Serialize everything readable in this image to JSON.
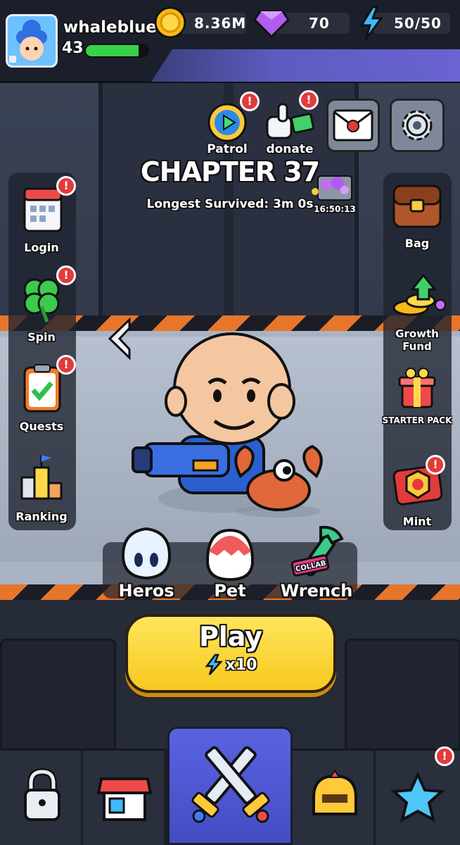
{
  "player": {
    "name": "whaleblue",
    "level": "43",
    "xp_fraction": 0.85
  },
  "resources": {
    "coins": "8.36M",
    "gems": "70",
    "energy": "50/50"
  },
  "top_actions": {
    "patrol": "Patrol",
    "donate": "donate",
    "chest_timer": "16:50:13"
  },
  "left_menu": [
    {
      "label": "Login",
      "icon": "calendar-icon",
      "badge": "!"
    },
    {
      "label": "Spin",
      "icon": "clover-icon",
      "badge": "!"
    },
    {
      "label": "Quests",
      "icon": "clipboard-icon",
      "badge": "!"
    },
    {
      "label": "Ranking",
      "icon": "podium-icon",
      "badge": ""
    }
  ],
  "right_menu": [
    {
      "label": "Bag",
      "icon": "bag-icon",
      "badge": ""
    },
    {
      "label": "Growth Fund",
      "icon": "coins-icon",
      "badge": ""
    },
    {
      "label": "STARTER PACK",
      "icon": "gift-icon",
      "badge": ""
    },
    {
      "label": "Mint",
      "icon": "mint-icon",
      "badge": "!"
    }
  ],
  "chapter": {
    "title": "CHAPTER 37",
    "subtitle": "Longest Survived: 3m 0s"
  },
  "loadout": {
    "heros": "Heros",
    "pet": "Pet",
    "wrench": "Wrench",
    "collab_tag": "COLLAB"
  },
  "play": {
    "label": "Play",
    "cost": "x10"
  },
  "badges": {
    "alert": "!"
  },
  "bottom_nav": [
    "lock-icon",
    "shop-icon",
    "battle-icon",
    "helmet-icon",
    "star-gem-icon"
  ],
  "colors": {
    "accent": "#6a63d2",
    "play": "#f6c91d",
    "alert": "#e23b3b",
    "xp": "#36d24a"
  }
}
